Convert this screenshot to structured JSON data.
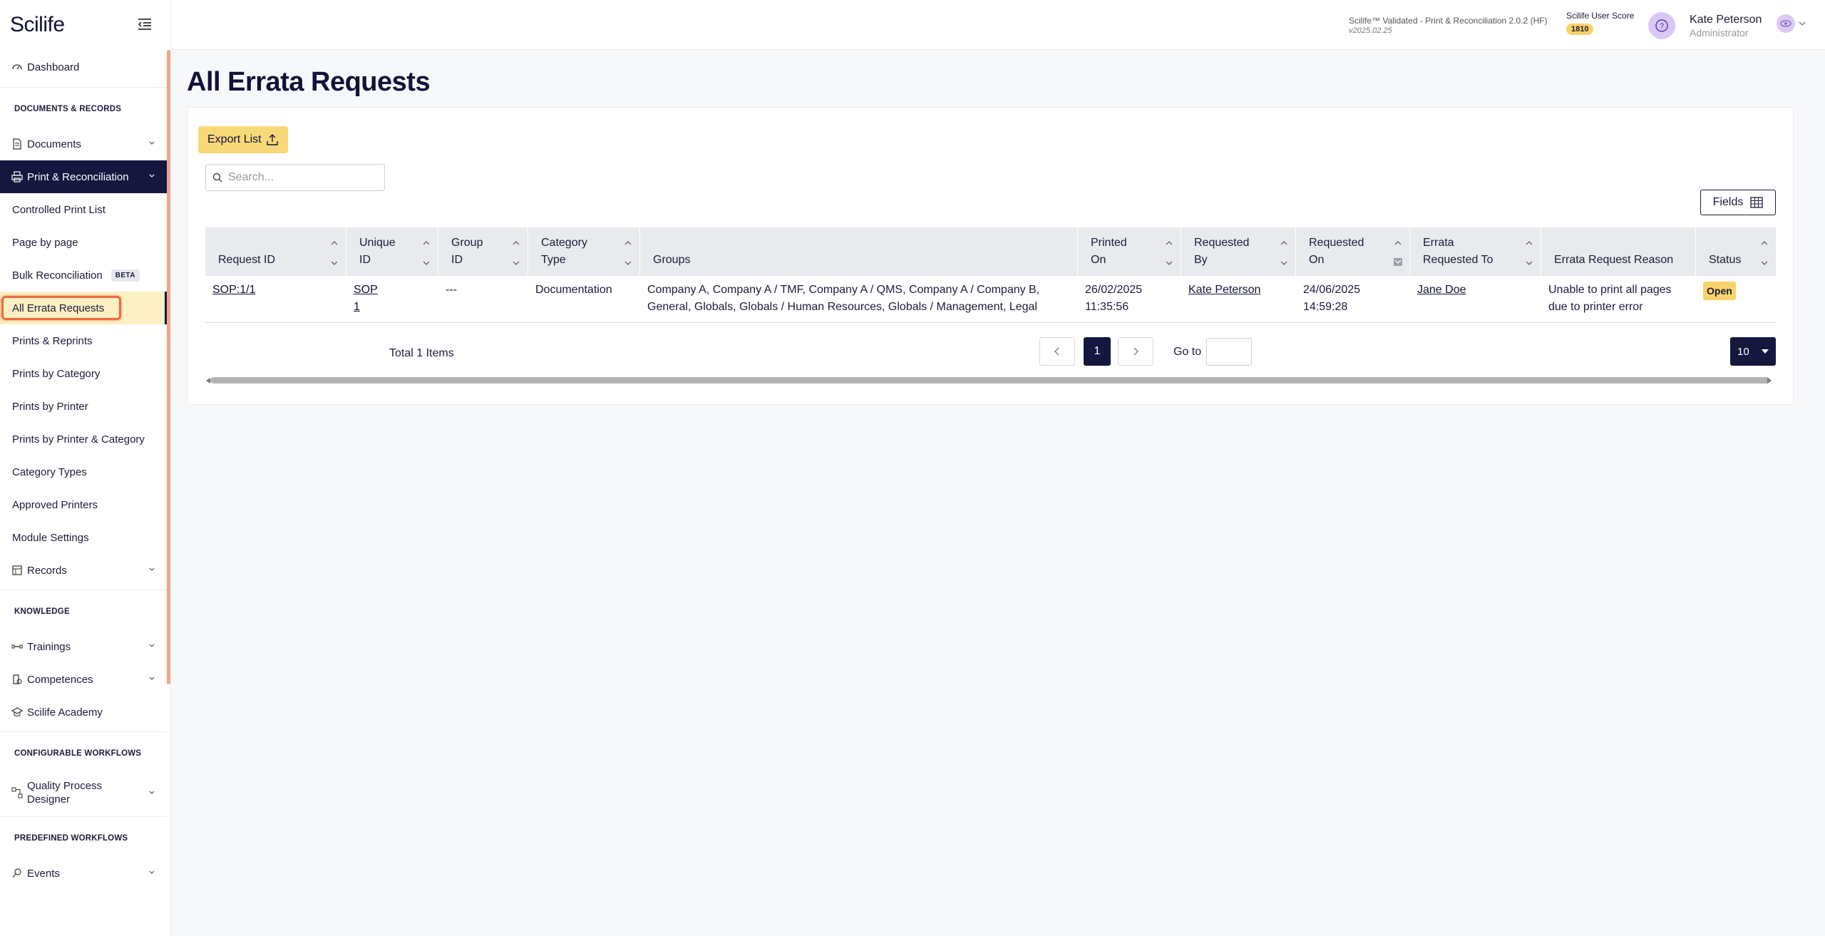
{
  "app": {
    "logo": "Scilife"
  },
  "header": {
    "version_line1": "Scilife™ Validated - Print & Reconciliation 2.0.2 (HF)",
    "version_line2": "v2025.02.25",
    "score_label": "Scilife User Score",
    "score_value": "1810",
    "user_name": "Kate Peterson",
    "user_role": "Administrator"
  },
  "sidebar": {
    "dashboard": "Dashboard",
    "section_docs": "DOCUMENTS & RECORDS",
    "documents": "Documents",
    "print_recon": "Print & Reconciliation",
    "sub_items": [
      "Controlled Print List",
      "Page by page",
      "Bulk Reconciliation",
      "All Errata Requests",
      "Prints & Reprints",
      "Prints by Category",
      "Prints by Printer",
      "Prints by Printer & Category",
      "Category Types",
      "Approved Printers",
      "Module Settings"
    ],
    "beta_badge": "BETA",
    "records": "Records",
    "section_knowledge": "KNOWLEDGE",
    "trainings": "Trainings",
    "competences": "Competences",
    "academy": "Scilife Academy",
    "section_workflows": "CONFIGURABLE WORKFLOWS",
    "qpd_line1": "Quality Process",
    "qpd_line2": "Designer",
    "section_predefined": "PREDEFINED WORKFLOWS",
    "events": "Events"
  },
  "main": {
    "title": "All Errata Requests",
    "export_label": "Export List",
    "search_placeholder": "Search...",
    "fields_label": "Fields",
    "total": "Total 1 Items",
    "current_page": "1",
    "goto_label": "Go to",
    "page_size": "10"
  },
  "table": {
    "columns": [
      {
        "line1": "Request ID",
        "line2": ""
      },
      {
        "line1": "Unique",
        "line2": "ID"
      },
      {
        "line1": "Group",
        "line2": "ID"
      },
      {
        "line1": "Category",
        "line2": "Type"
      },
      {
        "line1": "Groups",
        "line2": ""
      },
      {
        "line1": "Printed",
        "line2": "On"
      },
      {
        "line1": "Requested",
        "line2": "By"
      },
      {
        "line1": "Requested",
        "line2": "On"
      },
      {
        "line1": "Errata",
        "line2": "Requested To"
      },
      {
        "line1": "Errata Request Reason",
        "line2": ""
      },
      {
        "line1": "Status",
        "line2": ""
      }
    ],
    "row": {
      "request_id": "SOP:1/1",
      "unique_id_1": "SOP",
      "unique_id_2": "1",
      "group_id": "---",
      "category_type": "Documentation",
      "groups_1": "Company A, Company A / TMF, Company A / QMS, Company A / Company B,",
      "groups_2": "General, Globals, Globals / Human Resources, Globals / Management, Legal",
      "printed_1": "26/02/2025",
      "printed_2": "11:35:56",
      "requested_by": "Kate Peterson",
      "requested_on_1": "24/06/2025",
      "requested_on_2": "14:59:28",
      "requested_to": "Jane Doe",
      "reason_1": "Unable to print all pages",
      "reason_2": "due to printer error",
      "status": "Open"
    }
  }
}
